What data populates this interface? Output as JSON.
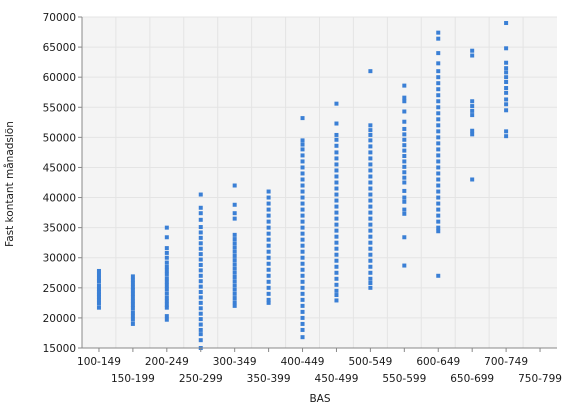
{
  "chart_data": {
    "type": "scatter",
    "xlabel": "BAS",
    "ylabel": "Fast kontant månadslön",
    "categories": [
      "100-149",
      "150-199",
      "200-249",
      "250-299",
      "300-349",
      "350-399",
      "400-449",
      "450-499",
      "500-549",
      "550-599",
      "600-649",
      "650-699",
      "700-749",
      "750-799"
    ],
    "ylim": [
      15000,
      70000
    ],
    "yticks": [
      15000,
      20000,
      25000,
      30000,
      35000,
      40000,
      45000,
      50000,
      55000,
      60000,
      65000,
      70000
    ],
    "grid": true,
    "colors": {
      "point": "#3a7fd5",
      "plot_bg": "#f4f4f4",
      "grid": "#e4e4e4",
      "axis": "#888888"
    },
    "series": [
      {
        "values": [
          [
            0,
            27800
          ],
          [
            0,
            27200
          ],
          [
            0,
            26600
          ],
          [
            0,
            26100
          ],
          [
            0,
            25400
          ],
          [
            0,
            24800
          ],
          [
            0,
            24300
          ],
          [
            0,
            23900
          ],
          [
            0,
            23500
          ],
          [
            0,
            23000
          ],
          [
            0,
            22400
          ],
          [
            0,
            21700
          ],
          [
            1,
            26900
          ],
          [
            1,
            26300
          ],
          [
            1,
            25700
          ],
          [
            1,
            25100
          ],
          [
            1,
            24600
          ],
          [
            1,
            24000
          ],
          [
            1,
            23400
          ],
          [
            1,
            22800
          ],
          [
            1,
            22200
          ],
          [
            1,
            21600
          ],
          [
            1,
            20900
          ],
          [
            1,
            20300
          ],
          [
            1,
            19700
          ],
          [
            1,
            19000
          ],
          [
            2,
            35000
          ],
          [
            2,
            33400
          ],
          [
            2,
            31600
          ],
          [
            2,
            30800
          ],
          [
            2,
            30000
          ],
          [
            2,
            29200
          ],
          [
            2,
            28500
          ],
          [
            2,
            27900
          ],
          [
            2,
            27300
          ],
          [
            2,
            26600
          ],
          [
            2,
            26000
          ],
          [
            2,
            25400
          ],
          [
            2,
            24800
          ],
          [
            2,
            24100
          ],
          [
            2,
            23400
          ],
          [
            2,
            22800
          ],
          [
            2,
            22200
          ],
          [
            2,
            21700
          ],
          [
            2,
            20300
          ],
          [
            2,
            19700
          ],
          [
            3,
            40500
          ],
          [
            3,
            38300
          ],
          [
            3,
            37400
          ],
          [
            3,
            36300
          ],
          [
            3,
            35100
          ],
          [
            3,
            34200
          ],
          [
            3,
            33300
          ],
          [
            3,
            32400
          ],
          [
            3,
            31500
          ],
          [
            3,
            30600
          ],
          [
            3,
            29700
          ],
          [
            3,
            28800
          ],
          [
            3,
            27900
          ],
          [
            3,
            27000
          ],
          [
            3,
            26100
          ],
          [
            3,
            25200
          ],
          [
            3,
            24300
          ],
          [
            3,
            23400
          ],
          [
            3,
            22500
          ],
          [
            3,
            21600
          ],
          [
            3,
            20700
          ],
          [
            3,
            19800
          ],
          [
            3,
            18900
          ],
          [
            3,
            18000
          ],
          [
            3,
            17300
          ],
          [
            3,
            16300
          ],
          [
            3,
            15000
          ],
          [
            4,
            42000
          ],
          [
            4,
            38800
          ],
          [
            4,
            37400
          ],
          [
            4,
            36500
          ],
          [
            4,
            33800
          ],
          [
            4,
            33100
          ],
          [
            4,
            32400
          ],
          [
            4,
            31700
          ],
          [
            4,
            31000
          ],
          [
            4,
            30300
          ],
          [
            4,
            29600
          ],
          [
            4,
            28900
          ],
          [
            4,
            28200
          ],
          [
            4,
            27500
          ],
          [
            4,
            26800
          ],
          [
            4,
            26100
          ],
          [
            4,
            25400
          ],
          [
            4,
            24700
          ],
          [
            4,
            24000
          ],
          [
            4,
            23300
          ],
          [
            4,
            22600
          ],
          [
            4,
            22000
          ],
          [
            5,
            41000
          ],
          [
            5,
            40000
          ],
          [
            5,
            39000
          ],
          [
            5,
            38000
          ],
          [
            5,
            37000
          ],
          [
            5,
            36000
          ],
          [
            5,
            35000
          ],
          [
            5,
            34000
          ],
          [
            5,
            33000
          ],
          [
            5,
            32000
          ],
          [
            5,
            31000
          ],
          [
            5,
            30000
          ],
          [
            5,
            29000
          ],
          [
            5,
            28000
          ],
          [
            5,
            27000
          ],
          [
            5,
            26000
          ],
          [
            5,
            25000
          ],
          [
            5,
            24000
          ],
          [
            5,
            23000
          ],
          [
            5,
            22500
          ],
          [
            6,
            53200
          ],
          [
            6,
            49500
          ],
          [
            6,
            48800
          ],
          [
            6,
            48000
          ],
          [
            6,
            47000
          ],
          [
            6,
            46000
          ],
          [
            6,
            45000
          ],
          [
            6,
            44000
          ],
          [
            6,
            43000
          ],
          [
            6,
            42000
          ],
          [
            6,
            41000
          ],
          [
            6,
            40000
          ],
          [
            6,
            39000
          ],
          [
            6,
            38000
          ],
          [
            6,
            37000
          ],
          [
            6,
            36000
          ],
          [
            6,
            35000
          ],
          [
            6,
            34000
          ],
          [
            6,
            33000
          ],
          [
            6,
            32000
          ],
          [
            6,
            31000
          ],
          [
            6,
            30000
          ],
          [
            6,
            29000
          ],
          [
            6,
            28000
          ],
          [
            6,
            27000
          ],
          [
            6,
            26000
          ],
          [
            6,
            25000
          ],
          [
            6,
            24000
          ],
          [
            6,
            23000
          ],
          [
            6,
            22000
          ],
          [
            6,
            21000
          ],
          [
            6,
            20000
          ],
          [
            6,
            19000
          ],
          [
            6,
            18000
          ],
          [
            6,
            16800
          ],
          [
            7,
            55600
          ],
          [
            7,
            52300
          ],
          [
            7,
            50400
          ],
          [
            7,
            49600
          ],
          [
            7,
            48600
          ],
          [
            7,
            47500
          ],
          [
            7,
            46500
          ],
          [
            7,
            45500
          ],
          [
            7,
            44500
          ],
          [
            7,
            43500
          ],
          [
            7,
            42500
          ],
          [
            7,
            41500
          ],
          [
            7,
            40500
          ],
          [
            7,
            39500
          ],
          [
            7,
            38500
          ],
          [
            7,
            37500
          ],
          [
            7,
            36500
          ],
          [
            7,
            35500
          ],
          [
            7,
            34500
          ],
          [
            7,
            33500
          ],
          [
            7,
            32500
          ],
          [
            7,
            31500
          ],
          [
            7,
            30500
          ],
          [
            7,
            29500
          ],
          [
            7,
            28500
          ],
          [
            7,
            27500
          ],
          [
            7,
            26500
          ],
          [
            7,
            25500
          ],
          [
            7,
            24500
          ],
          [
            7,
            23800
          ],
          [
            7,
            22900
          ],
          [
            8,
            61000
          ],
          [
            8,
            52000
          ],
          [
            8,
            51200
          ],
          [
            8,
            50400
          ],
          [
            8,
            49500
          ],
          [
            8,
            48500
          ],
          [
            8,
            47500
          ],
          [
            8,
            46500
          ],
          [
            8,
            45500
          ],
          [
            8,
            44500
          ],
          [
            8,
            43500
          ],
          [
            8,
            42500
          ],
          [
            8,
            41500
          ],
          [
            8,
            40500
          ],
          [
            8,
            39500
          ],
          [
            8,
            38500
          ],
          [
            8,
            37500
          ],
          [
            8,
            36500
          ],
          [
            8,
            35500
          ],
          [
            8,
            34500
          ],
          [
            8,
            33500
          ],
          [
            8,
            32500
          ],
          [
            8,
            31500
          ],
          [
            8,
            30500
          ],
          [
            8,
            29500
          ],
          [
            8,
            28500
          ],
          [
            8,
            27500
          ],
          [
            8,
            26500
          ],
          [
            8,
            25800
          ],
          [
            8,
            25000
          ],
          [
            9,
            58600
          ],
          [
            9,
            56600
          ],
          [
            9,
            56000
          ],
          [
            9,
            54300
          ],
          [
            9,
            52600
          ],
          [
            9,
            51400
          ],
          [
            9,
            50500
          ],
          [
            9,
            49600
          ],
          [
            9,
            48700
          ],
          [
            9,
            47800
          ],
          [
            9,
            46900
          ],
          [
            9,
            46000
          ],
          [
            9,
            45100
          ],
          [
            9,
            44200
          ],
          [
            9,
            43300
          ],
          [
            9,
            42500
          ],
          [
            9,
            41100
          ],
          [
            9,
            40000
          ],
          [
            9,
            39300
          ],
          [
            9,
            38000
          ],
          [
            9,
            37300
          ],
          [
            9,
            33400
          ],
          [
            9,
            28700
          ],
          [
            10,
            67400
          ],
          [
            10,
            66400
          ],
          [
            10,
            64000
          ],
          [
            10,
            62300
          ],
          [
            10,
            61000
          ],
          [
            10,
            60000
          ],
          [
            10,
            59000
          ],
          [
            10,
            58000
          ],
          [
            10,
            57000
          ],
          [
            10,
            56000
          ],
          [
            10,
            55000
          ],
          [
            10,
            54000
          ],
          [
            10,
            53000
          ],
          [
            10,
            52000
          ],
          [
            10,
            51000
          ],
          [
            10,
            50000
          ],
          [
            10,
            49000
          ],
          [
            10,
            48000
          ],
          [
            10,
            47000
          ],
          [
            10,
            46000
          ],
          [
            10,
            45000
          ],
          [
            10,
            44000
          ],
          [
            10,
            43000
          ],
          [
            10,
            42000
          ],
          [
            10,
            41000
          ],
          [
            10,
            40000
          ],
          [
            10,
            39000
          ],
          [
            10,
            38000
          ],
          [
            10,
            37000
          ],
          [
            10,
            36000
          ],
          [
            10,
            35000
          ],
          [
            10,
            34400
          ],
          [
            10,
            27000
          ],
          [
            11,
            64400
          ],
          [
            11,
            63600
          ],
          [
            11,
            56000
          ],
          [
            11,
            55200
          ],
          [
            11,
            54400
          ],
          [
            11,
            53700
          ],
          [
            11,
            51100
          ],
          [
            11,
            50500
          ],
          [
            11,
            43000
          ],
          [
            12,
            69000
          ],
          [
            12,
            64800
          ],
          [
            12,
            62400
          ],
          [
            12,
            61500
          ],
          [
            12,
            60800
          ],
          [
            12,
            60000
          ],
          [
            12,
            59200
          ],
          [
            12,
            58200
          ],
          [
            12,
            57400
          ],
          [
            12,
            56300
          ],
          [
            12,
            55500
          ],
          [
            12,
            54500
          ],
          [
            12,
            51000
          ],
          [
            12,
            50200
          ]
        ]
      }
    ]
  }
}
